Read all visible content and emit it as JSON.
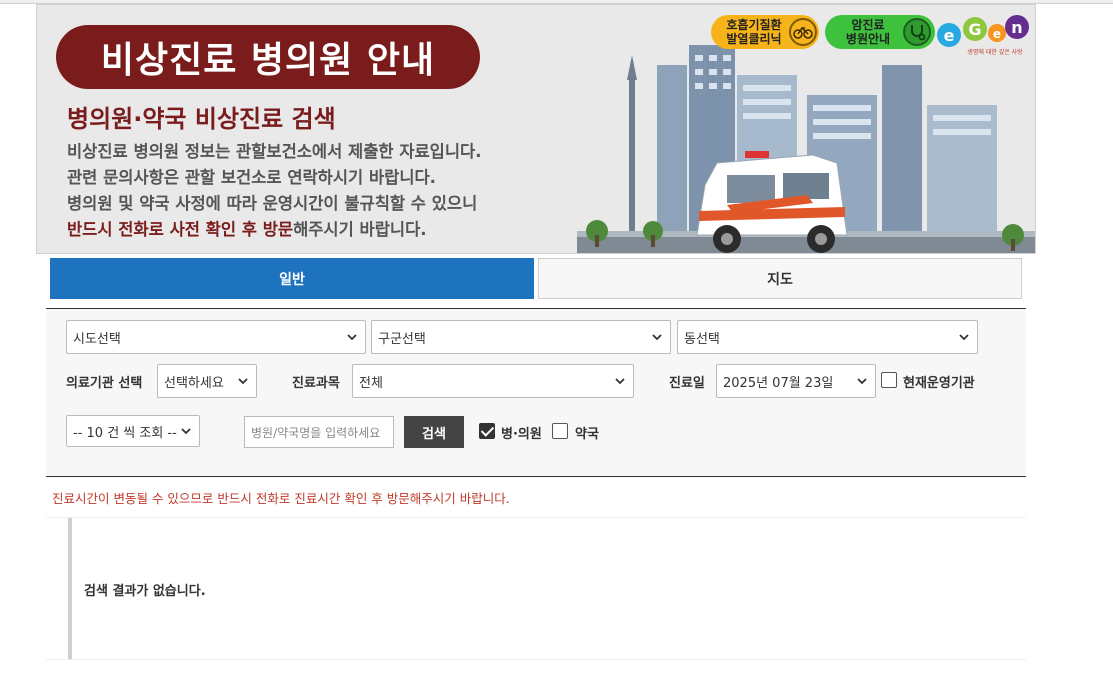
{
  "banner": {
    "title": "비상진료 병의원 안내",
    "subtitle": "병의원·약국 비상진료 검색",
    "desc_line1": "비상진료 병의원 정보는 관할보건소에서 제출한 자료입니다.",
    "desc_line2": "관련 문의사항은 관할 보건소로 연락하시기 바랍니다.",
    "desc_line3": "병의원 및 약국 사정에 따라 운영시간이 불규칙할 수 있으니",
    "desc_line4_emphasis": "반드시 전화로 사전 확인 후 방문",
    "desc_line4_rest": "해주시기 바랍니다.",
    "badge_resp_line1": "호흡기질환",
    "badge_resp_line2": "발열클리닉",
    "badge_cancer_line1": "암진료",
    "badge_cancer_line2": "병원안내",
    "brand_tagline": "생명에 대한 깊은 사랑"
  },
  "tabs": [
    {
      "label": "일반",
      "active": true
    },
    {
      "label": "지도",
      "active": false
    }
  ],
  "filters": {
    "sido": "시도선택",
    "gugun": "구군선택",
    "dong": "동선택",
    "inst_label": "의료기관 선택",
    "inst_value": "선택하세요",
    "dept_label": "진료과목",
    "dept_value": "전체",
    "date_label": "진료일",
    "date_value": "2025년 07월 23일",
    "open_now_label": "현재운영기관",
    "open_now_checked": false,
    "page_size": "-- 10 건 씩 조회 --",
    "search_placeholder": "병원/약국명을 입력하세요",
    "search_button": "검색",
    "hospital_label": "병·의원",
    "hospital_checked": true,
    "pharmacy_label": "약국",
    "pharmacy_checked": false
  },
  "notice": "진료시간이 변동될 수 있으므로 반드시 전화로 진료시간 확인 후 방문해주시기 바랍니다.",
  "result_message": "검색 결과가 없습니다.",
  "colors": {
    "brand_red": "#7b1c1c",
    "tab_blue": "#1e73be",
    "notice_red": "#c0392b"
  }
}
